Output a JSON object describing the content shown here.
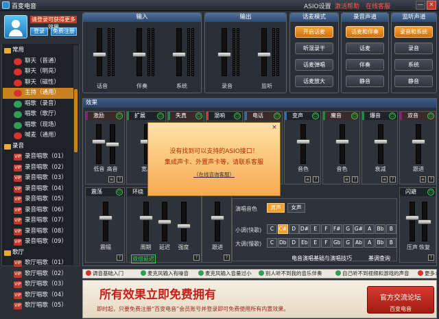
{
  "titlebar": {
    "title": "百变电音",
    "asio": "ASIO设置",
    "register": "激活帮助",
    "more": "在线客服",
    "minimize": "—",
    "close": "×"
  },
  "user": {
    "notice": "请登录可获得更多效果",
    "login": "登录",
    "register": "免费注册"
  },
  "tree": {
    "groups": [
      {
        "label": "常用",
        "items": [
          {
            "label": "聊天（普通）",
            "badge": "chat"
          },
          {
            "label": "聊天（明亮）",
            "badge": "chat"
          },
          {
            "label": "聊天（磁性）",
            "badge": "chat"
          },
          {
            "label": "主持（通用）",
            "badge": "chat",
            "selected": true
          },
          {
            "label": "唱歌（录音）",
            "badge": "sing"
          },
          {
            "label": "唱歌（歌厅）",
            "badge": "sing"
          },
          {
            "label": "唱歌（现场）",
            "badge": "sing"
          },
          {
            "label": "喊麦（通用）",
            "badge": "chat"
          }
        ]
      },
      {
        "label": "录音",
        "items": [
          {
            "label": "录音唱歌（01）",
            "badge": "vip"
          },
          {
            "label": "录音唱歌（02）",
            "badge": "vip"
          },
          {
            "label": "录音唱歌（03）",
            "badge": "vip"
          },
          {
            "label": "录音唱歌（04）",
            "badge": "vip"
          },
          {
            "label": "录音唱歌（05）",
            "badge": "vip"
          },
          {
            "label": "录音唱歌（06）",
            "badge": "vip"
          },
          {
            "label": "录音唱歌（07）",
            "badge": "vip"
          },
          {
            "label": "录音唱歌（08）",
            "badge": "vip"
          },
          {
            "label": "录音唱歌（09）",
            "badge": "vip"
          }
        ]
      },
      {
        "label": "歌厅",
        "items": [
          {
            "label": "歌厅唱歌（01）",
            "badge": "vip"
          },
          {
            "label": "歌厅唱歌（02）",
            "badge": "vip"
          },
          {
            "label": "歌厅唱歌（03）",
            "badge": "vip"
          },
          {
            "label": "歌厅唱歌（04）",
            "badge": "vip"
          },
          {
            "label": "歌厅唱歌（05）",
            "badge": "vip"
          }
        ]
      }
    ]
  },
  "input": {
    "title": "输入",
    "channels": [
      "话音",
      "伴奏",
      "系统"
    ]
  },
  "output": {
    "title": "输出",
    "channels": [
      "录音",
      "监听"
    ]
  },
  "voicemode": {
    "title": "话麦模式",
    "buttons": [
      "开启话麦",
      "听混录干",
      "话麦弹唱",
      "话麦放大"
    ]
  },
  "recordchannel": {
    "title": "录音声道",
    "buttons": [
      "话麦和伴奏",
      "话麦",
      "伴奏",
      "静音"
    ]
  },
  "monitorchannel": {
    "title": "监听声道",
    "buttons": [
      "录音和系统",
      "录音",
      "系统",
      "静音"
    ]
  },
  "effects": {
    "title": "效果",
    "top": [
      {
        "name": "激励",
        "labels": [
          "低音",
          "高音"
        ]
      },
      {
        "name": "扩展",
        "labels": [
          "宽度"
        ]
      },
      {
        "name": "失真",
        "labels": []
      },
      {
        "name": "混响",
        "labels": []
      },
      {
        "name": "电话",
        "labels": []
      },
      {
        "name": "变声",
        "labels": [
          "音色"
        ]
      },
      {
        "name": "魔音",
        "labels": [
          "音色"
        ]
      },
      {
        "name": "爆音",
        "labels": [
          "衰减"
        ]
      },
      {
        "name": "双音",
        "labels": [
          "跟进"
        ]
      }
    ],
    "bottom": [
      {
        "name": "震荡",
        "labels": [
          "震幅"
        ]
      },
      {
        "name": "环绕",
        "labels": [
          "周期",
          "延迟",
          "强度"
        ]
      },
      {
        "name": "和声",
        "labels": [
          "跟进"
        ]
      },
      {
        "name": "闪避",
        "labels": [
          "压声",
          "恢复"
        ]
      }
    ],
    "harmony": {
      "color_label": "演唱音色",
      "male": "男声",
      "female": "女声",
      "minor_label": "小调(快歌)",
      "major_label": "大调(慢歌)",
      "minor_keys": [
        "C",
        "C#",
        "D",
        "D#",
        "E",
        "F",
        "F#",
        "G",
        "G#",
        "A",
        "Bb",
        "B"
      ],
      "major_keys": [
        "C",
        "Db",
        "D",
        "Eb",
        "E",
        "F",
        "Gb",
        "G",
        "Ab",
        "A",
        "Bb",
        "B"
      ],
      "selected_minor_index": 1,
      "footer_link": "电音演唱基础与演唱技巧",
      "detect": "基调查询"
    },
    "doubling_link": "双倍延迟"
  },
  "popup": {
    "line1": "没有找到可以支持的ASIO接口！",
    "line2": "集成声卡、外置声卡等，请联系客服",
    "link": "（在线咨询客服）",
    "close": "×"
  },
  "tips": [
    {
      "text": "调音基础入门",
      "color": "#d7322d"
    },
    {
      "text": "麦克风输入有噪音",
      "color": "#2e9e55"
    },
    {
      "text": "麦克风输入音量过小",
      "color": "#2e9e55"
    },
    {
      "text": "别人听不到我的音乐伴奏",
      "color": "#2e9e55"
    },
    {
      "text": "自己听不到视频和游戏的声音",
      "color": "#2e9e55"
    },
    {
      "text": "更多>>",
      "color": "#d7322d"
    }
  ],
  "ad": {
    "headline": "所有效果立即免费拥有",
    "sub": "即时起，只要免费注册“百变电音”会员账号并登录即可免费使用所有内置效果。",
    "btn_top": "官方交流论坛",
    "btn_bottom": "百变电音"
  },
  "levels": {
    "input": [
      0.0,
      0.0,
      0.0
    ],
    "output": [
      0.0,
      0.0
    ]
  }
}
